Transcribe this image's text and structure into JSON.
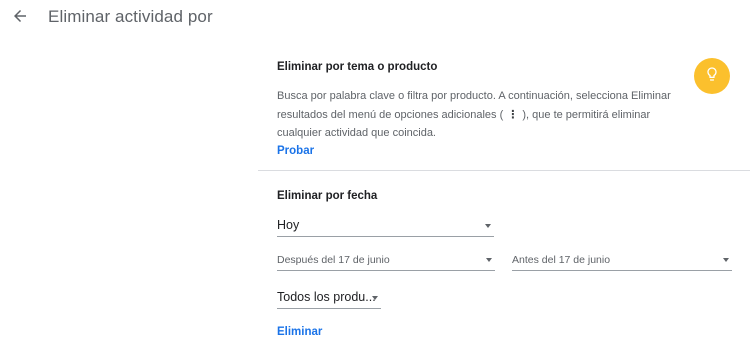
{
  "header": {
    "back_icon": "arrow-back-icon",
    "title": "Eliminar actividad por"
  },
  "topic_section": {
    "title": "Eliminar por tema o producto",
    "description_part1": "Busca por palabra clave o filtra por producto. A continuación, selecciona Eliminar resultados del menú de opciones adicionales (",
    "more_icon": "⋮",
    "description_part2": "), que te permitirá eliminar cualquier actividad que coincida.",
    "link": "Probar",
    "tip_icon": "lightbulb-icon",
    "tip_color": "#fbc02d"
  },
  "date_section": {
    "title": "Eliminar por fecha",
    "range_select": {
      "value": "Hoy"
    },
    "after_select": {
      "value": "Después del 17 de junio"
    },
    "before_select": {
      "value": "Antes del 17 de junio"
    },
    "product_select": {
      "value": "Todos los produ..."
    },
    "delete_link": "Eliminar"
  },
  "colors": {
    "link": "#1a73e8",
    "divider": "#dadce0"
  }
}
